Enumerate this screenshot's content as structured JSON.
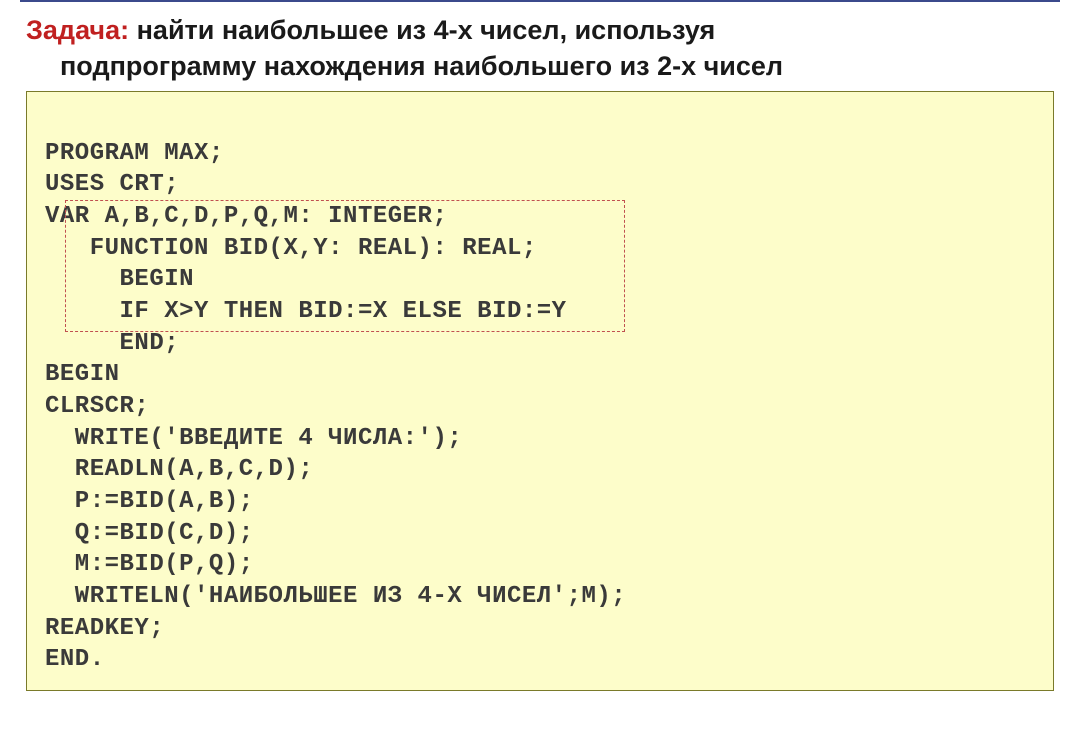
{
  "task": {
    "label": "Задача:",
    "line": "найти наибольшее из 4-х чисел, используя",
    "line2": "подпрограмму нахождения наибольшего из 2-х чисел"
  },
  "code": {
    "l01": "PROGRAM MAX;",
    "l02": "USES CRT;",
    "l03": "VAR A,B,C,D,P,Q,M: INTEGER;",
    "l04": "   FUNCTION BID(X,Y: REAL): REAL;",
    "l05": "     BEGIN",
    "l06": "     IF X>Y THEN BID:=X ELSE BID:=Y",
    "l07": "     END;",
    "l08": "BEGIN",
    "l09": "CLRSCR;",
    "l10": "  WRITE('ВВЕДИТЕ 4 ЧИСЛА:');",
    "l11": "  READLN(A,B,C,D);",
    "l12": "  P:=BID(A,B);",
    "l13": "  Q:=BID(C,D);",
    "l14": "  M:=BID(P,Q);",
    "l15": "  WRITELN('НАИБОЛЬШЕЕ ИЗ 4-Х ЧИСЕЛ';M);",
    "l16": "READKEY;",
    "l17": "END."
  }
}
